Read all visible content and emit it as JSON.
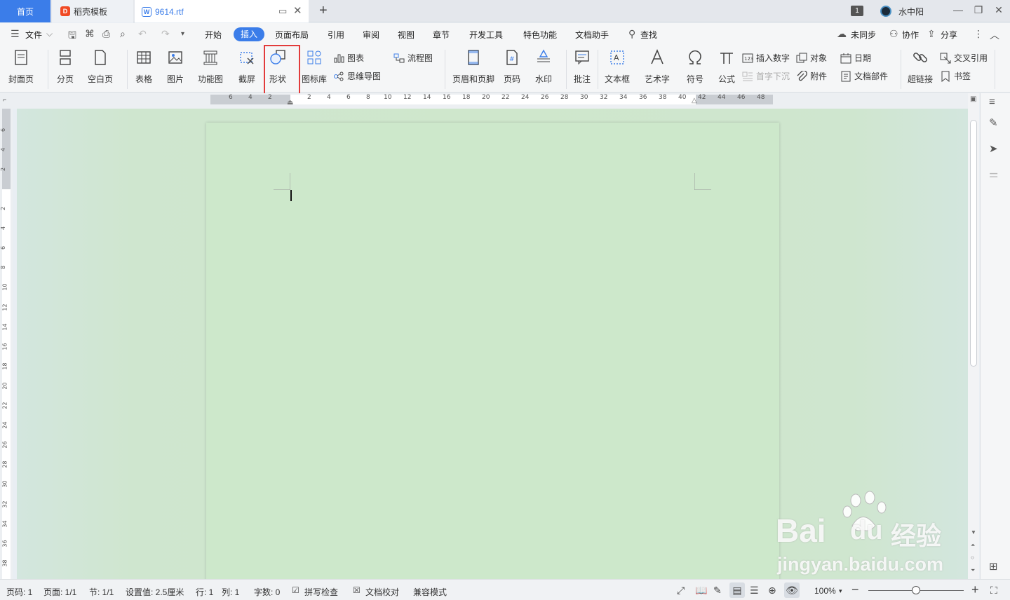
{
  "tabs": {
    "home": "首页",
    "daoke": "稻壳模板",
    "doc": "9614.rtf"
  },
  "titlebar": {
    "window_badge": "1",
    "username": "水中阳"
  },
  "menu": {
    "file": "文件",
    "items": [
      "开始",
      "插入",
      "页面布局",
      "引用",
      "审阅",
      "视图",
      "章节",
      "开发工具",
      "特色功能",
      "文档助手"
    ],
    "active": "插入",
    "search": "查找",
    "sync": "未同步",
    "collab": "协作",
    "share": "分享"
  },
  "ribbon": {
    "cover": "封面页",
    "pagebreak": "分页",
    "blank": "空白页",
    "table": "表格",
    "picture": "图片",
    "funcmap": "功能图",
    "screenshot": "截屏",
    "shape": "形状",
    "iconlib": "图标库",
    "chart": "图表",
    "mindmap": "思维导图",
    "flowchart": "流程图",
    "header_footer": "页眉和页脚",
    "page_num": "页码",
    "watermark": "水印",
    "comment": "批注",
    "textbox": "文本框",
    "wordart": "艺术字",
    "symbol": "符号",
    "formula": "公式",
    "insert_number": "插入数字",
    "dropcap": "首字下沉",
    "object": "对象",
    "attachment": "附件",
    "date": "日期",
    "docparts": "文档部件",
    "hyperlink": "超链接",
    "crossref": "交叉引用",
    "bookmark": "书签"
  },
  "ruler": {
    "h_left": [
      "6",
      "4",
      "2"
    ],
    "h_right": [
      "2",
      "4",
      "6",
      "8",
      "10",
      "12",
      "14",
      "16",
      "18",
      "20",
      "22",
      "24",
      "26",
      "28",
      "30",
      "32",
      "34",
      "36",
      "38",
      "40",
      "42",
      "44",
      "46",
      "48"
    ],
    "v_top": [
      "6",
      "4",
      "2"
    ],
    "v_main": [
      "2",
      "4",
      "6",
      "8",
      "10",
      "12",
      "14",
      "16",
      "18",
      "20",
      "22",
      "24",
      "26",
      "28",
      "30",
      "32",
      "34",
      "36",
      "38"
    ]
  },
  "status": {
    "page_num": "页码: 1",
    "pages": "页面: 1/1",
    "section": "节: 1/1",
    "setting": "设置值: 2.5厘米",
    "row": "行: 1",
    "col": "列: 1",
    "wordcount": "字数: 0",
    "spellcheck": "拼写检查",
    "proofread": "文档校对",
    "compat": "兼容模式",
    "zoom": "100%"
  },
  "watermark": {
    "brand": "Bai",
    "brand2": "du",
    "cn": "经验",
    "url": "jingyan.baidu.com"
  },
  "colors": {
    "accent": "#3b7de9",
    "highlight_box": "#e23b3b",
    "page_bg": "#cde8cb"
  }
}
